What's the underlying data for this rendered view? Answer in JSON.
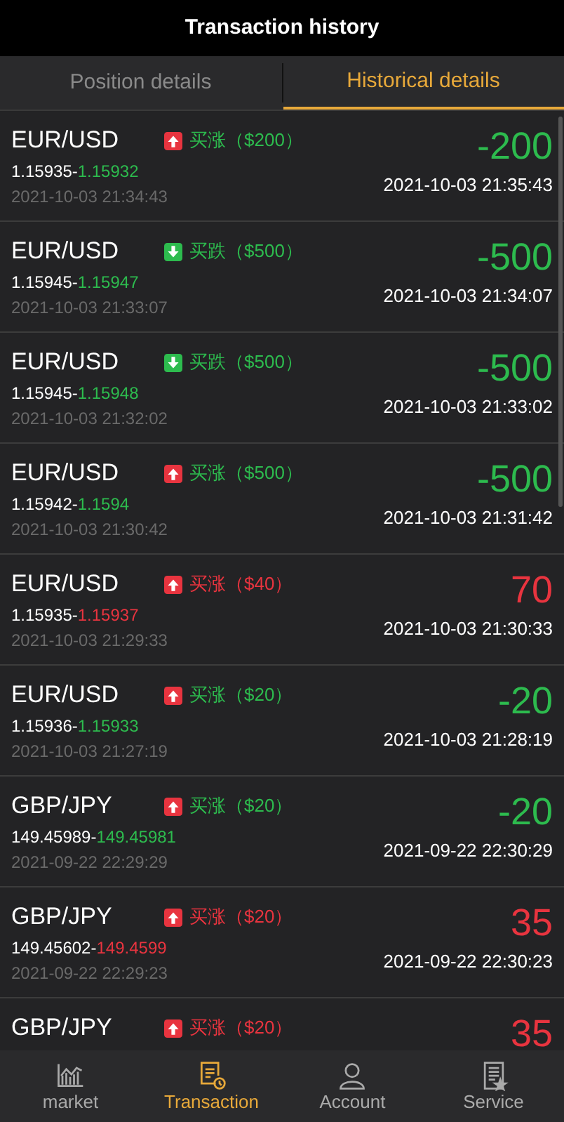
{
  "header": {
    "title": "Transaction history"
  },
  "tabs": [
    {
      "label": "Position details",
      "selected": false
    },
    {
      "label": "Historical details",
      "selected": true
    }
  ],
  "trades": [
    {
      "symbol": "EUR/USD",
      "up": true,
      "order": "买涨（$200）",
      "win": false,
      "open_price": "1.15935-",
      "close_price": "1.15932",
      "open_time": "2021-10-03 21:34:43",
      "profit": "-200",
      "close_time": "2021-10-03 21:35:43"
    },
    {
      "symbol": "EUR/USD",
      "up": false,
      "order": "买跌（$500）",
      "win": false,
      "open_price": "1.15945-",
      "close_price": "1.15947",
      "open_time": "2021-10-03 21:33:07",
      "profit": "-500",
      "close_time": "2021-10-03 21:34:07"
    },
    {
      "symbol": "EUR/USD",
      "up": false,
      "order": "买跌（$500）",
      "win": false,
      "open_price": "1.15945-",
      "close_price": "1.15948",
      "open_time": "2021-10-03 21:32:02",
      "profit": "-500",
      "close_time": "2021-10-03 21:33:02"
    },
    {
      "symbol": "EUR/USD",
      "up": true,
      "order": "买涨（$500）",
      "win": false,
      "open_price": "1.15942-",
      "close_price": "1.1594",
      "open_time": "2021-10-03 21:30:42",
      "profit": "-500",
      "close_time": "2021-10-03 21:31:42"
    },
    {
      "symbol": "EUR/USD",
      "up": true,
      "order": "买涨（$40）",
      "win": true,
      "open_price": "1.15935-",
      "close_price": "1.15937",
      "open_time": "2021-10-03 21:29:33",
      "profit": "70",
      "close_time": "2021-10-03 21:30:33"
    },
    {
      "symbol": "EUR/USD",
      "up": true,
      "order": "买涨（$20）",
      "win": false,
      "open_price": "1.15936-",
      "close_price": "1.15933",
      "open_time": "2021-10-03 21:27:19",
      "profit": "-20",
      "close_time": "2021-10-03 21:28:19"
    },
    {
      "symbol": "GBP/JPY",
      "up": true,
      "order": "买涨（$20）",
      "win": false,
      "open_price": "149.45989-",
      "close_price": "149.45981",
      "open_time": "2021-09-22 22:29:29",
      "profit": "-20",
      "close_time": "2021-09-22 22:30:29"
    },
    {
      "symbol": "GBP/JPY",
      "up": true,
      "order": "买涨（$20）",
      "win": true,
      "open_price": "149.45602-",
      "close_price": "149.4599",
      "open_time": "2021-09-22 22:29:23",
      "profit": "35",
      "close_time": "2021-09-22 22:30:23"
    },
    {
      "symbol": "GBP/JPY",
      "up": true,
      "order": "买涨（$20）",
      "win": true,
      "profit": "35"
    }
  ],
  "nav": [
    {
      "kind": "market",
      "label": "market",
      "selected": false
    },
    {
      "kind": "transaction",
      "label": "Transaction",
      "selected": true
    },
    {
      "kind": "account",
      "label": "Account",
      "selected": false
    },
    {
      "kind": "service",
      "label": "Service",
      "selected": false
    }
  ]
}
